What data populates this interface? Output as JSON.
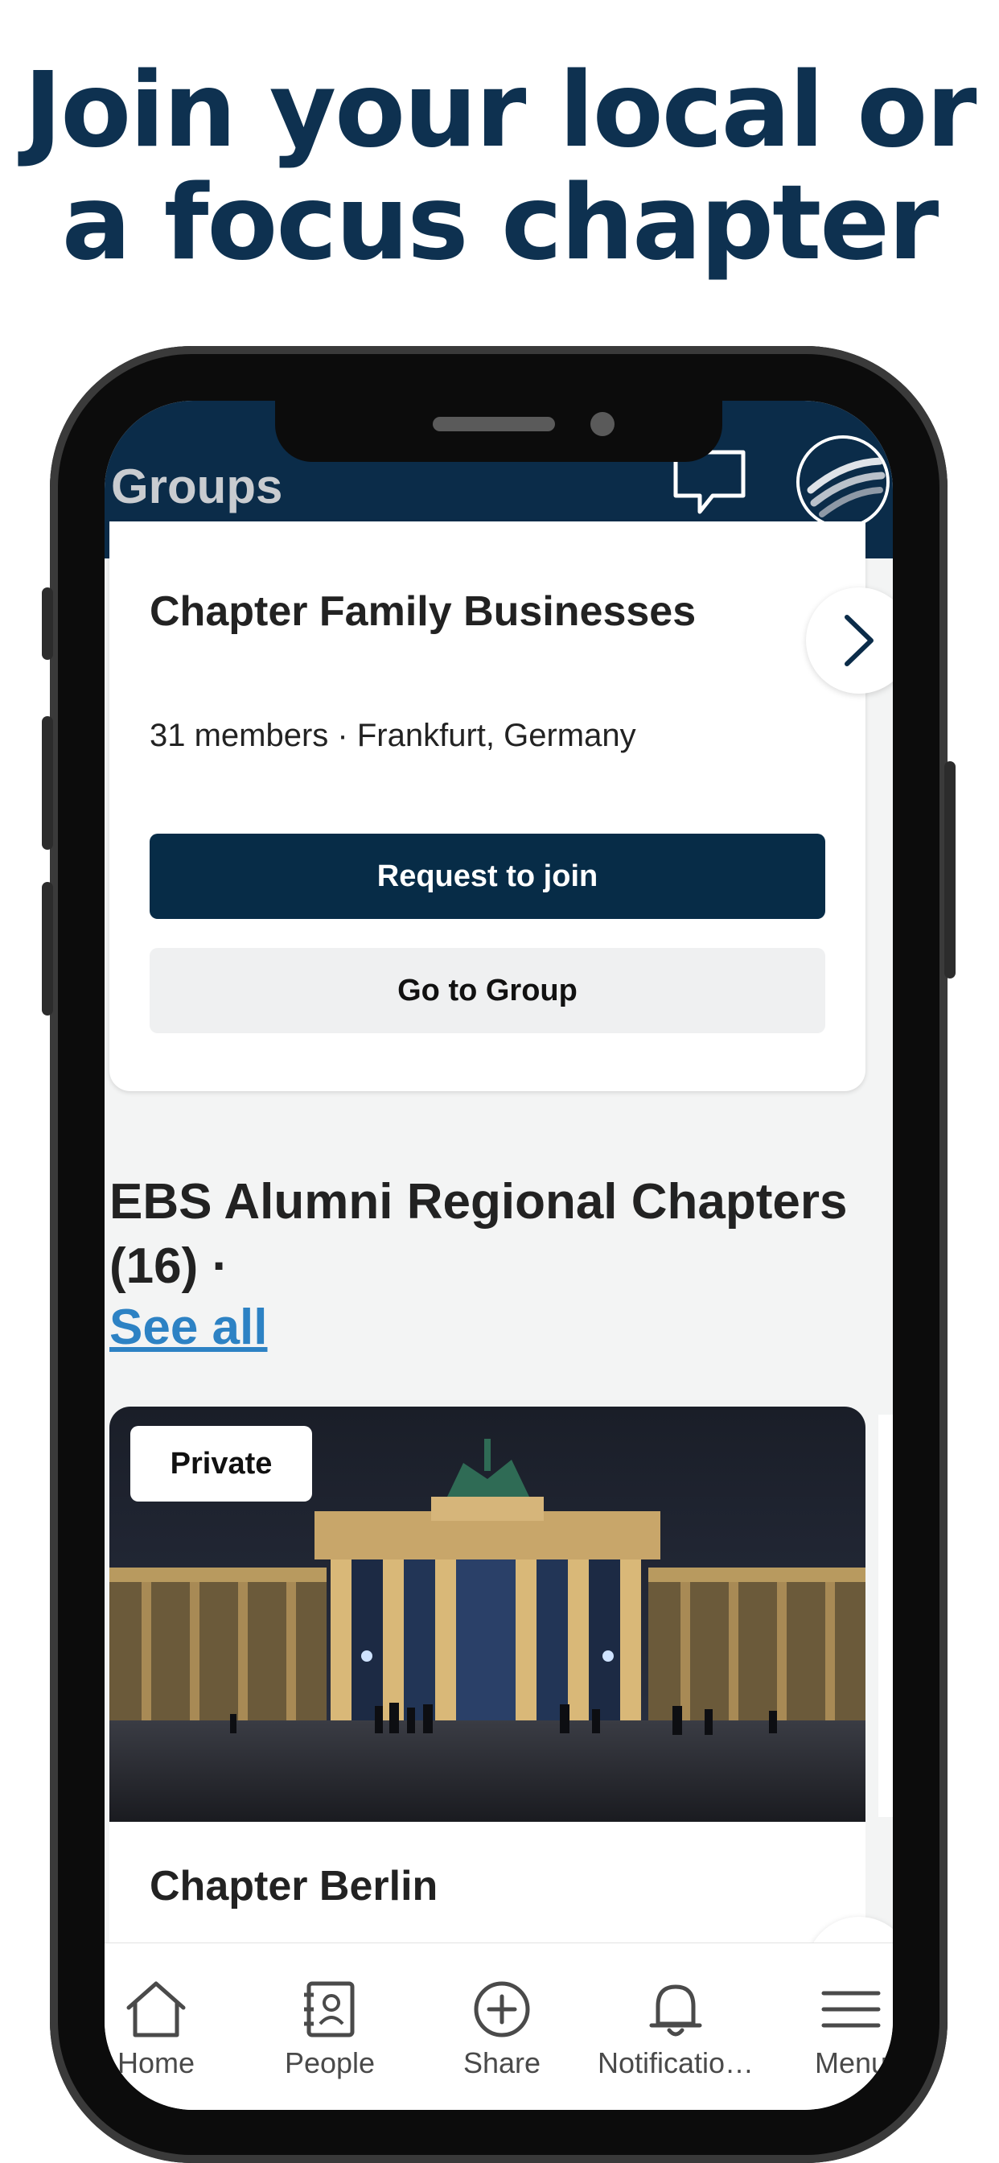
{
  "headline": {
    "line1": "Join your local or",
    "line2": "a focus chapter"
  },
  "app": {
    "title": "Groups",
    "icons": {
      "chat": "chat-bubble-icon",
      "avatar": "org-logo-icon"
    }
  },
  "featured_group": {
    "name": "Chapter Family Businesses",
    "meta": "31 members · Frankfurt, Germany",
    "request_label": "Request to join",
    "go_label": "Go to Group"
  },
  "section": {
    "title": "EBS Alumni Regional Chapters (16) ·",
    "see_all": "See all"
  },
  "group_card": {
    "badge": "Private",
    "name": "Chapter Berlin"
  },
  "tabbar": {
    "items": [
      {
        "label": "Home",
        "icon": "home-icon"
      },
      {
        "label": "People",
        "icon": "contacts-book-icon"
      },
      {
        "label": "Share",
        "icon": "plus-circle-icon"
      },
      {
        "label": "Notificatio…",
        "icon": "bell-icon"
      },
      {
        "label": "Menu",
        "icon": "hamburger-icon"
      }
    ]
  },
  "colors": {
    "navy": "#0b2c49",
    "headline": "#0e3150",
    "link": "#2d82c4"
  }
}
